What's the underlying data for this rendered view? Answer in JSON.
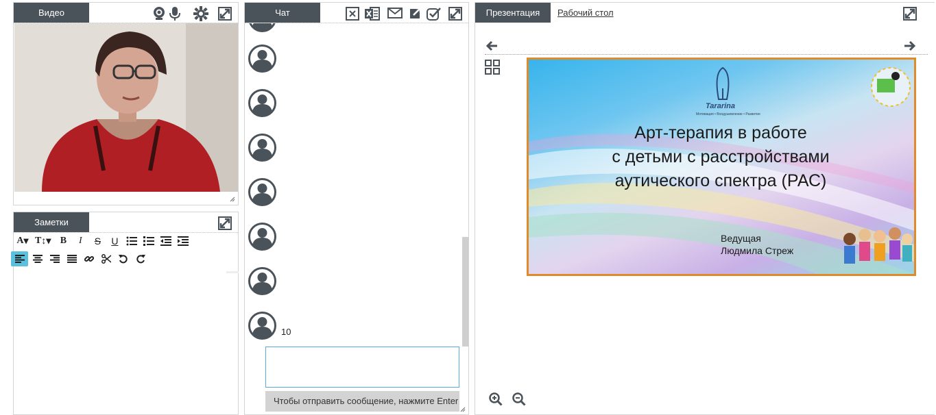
{
  "video": {
    "tab": "Видео",
    "icons": [
      "webcam-icon",
      "microphone-icon",
      "gear-icon",
      "expand-icon"
    ]
  },
  "notes": {
    "tab": "Заметки",
    "font_button": "A",
    "size_button": "T",
    "bold": "B",
    "italic": "I",
    "strike": "S",
    "underline": "U"
  },
  "chat": {
    "tab": "Чат",
    "messages": [
      {
        "text": ""
      },
      {
        "text": ""
      },
      {
        "text": ""
      },
      {
        "text": ""
      },
      {
        "text": ""
      },
      {
        "text": ""
      },
      {
        "text": "10"
      }
    ],
    "input_placeholder": "",
    "hint": "Чтобы отправить сообщение, нажмите Enter"
  },
  "presentation": {
    "tab": "Презентация",
    "desktop_tab": "Рабочий стол",
    "slide": {
      "logo": "Tararina",
      "logo_tagline": "Мотивация • Воодушевление • Развитие",
      "title_lines": [
        "Арт-терапия в работе",
        "с детьми с расстройствами",
        "аутического спектра (РАС)"
      ],
      "presenter_label": "Ведущая",
      "presenter_name": "Людмила Стреж"
    }
  },
  "colors": {
    "tab_bg": "#4a525a",
    "active_align": "#5bc0de",
    "slide_border": "#e08a2a",
    "input_border": "#5aa9d8"
  }
}
